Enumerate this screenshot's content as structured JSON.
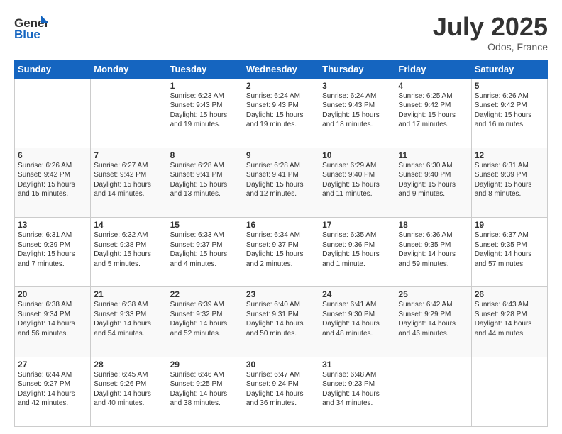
{
  "logo": {
    "general": "General",
    "blue": "Blue"
  },
  "title": "July 2025",
  "location": "Odos, France",
  "days_of_week": [
    "Sunday",
    "Monday",
    "Tuesday",
    "Wednesday",
    "Thursday",
    "Friday",
    "Saturday"
  ],
  "weeks": [
    [
      {
        "day": "",
        "sunrise": "",
        "sunset": "",
        "daylight": ""
      },
      {
        "day": "",
        "sunrise": "",
        "sunset": "",
        "daylight": ""
      },
      {
        "day": "1",
        "sunrise": "Sunrise: 6:23 AM",
        "sunset": "Sunset: 9:43 PM",
        "daylight": "Daylight: 15 hours and 19 minutes."
      },
      {
        "day": "2",
        "sunrise": "Sunrise: 6:24 AM",
        "sunset": "Sunset: 9:43 PM",
        "daylight": "Daylight: 15 hours and 19 minutes."
      },
      {
        "day": "3",
        "sunrise": "Sunrise: 6:24 AM",
        "sunset": "Sunset: 9:43 PM",
        "daylight": "Daylight: 15 hours and 18 minutes."
      },
      {
        "day": "4",
        "sunrise": "Sunrise: 6:25 AM",
        "sunset": "Sunset: 9:42 PM",
        "daylight": "Daylight: 15 hours and 17 minutes."
      },
      {
        "day": "5",
        "sunrise": "Sunrise: 6:26 AM",
        "sunset": "Sunset: 9:42 PM",
        "daylight": "Daylight: 15 hours and 16 minutes."
      }
    ],
    [
      {
        "day": "6",
        "sunrise": "Sunrise: 6:26 AM",
        "sunset": "Sunset: 9:42 PM",
        "daylight": "Daylight: 15 hours and 15 minutes."
      },
      {
        "day": "7",
        "sunrise": "Sunrise: 6:27 AM",
        "sunset": "Sunset: 9:42 PM",
        "daylight": "Daylight: 15 hours and 14 minutes."
      },
      {
        "day": "8",
        "sunrise": "Sunrise: 6:28 AM",
        "sunset": "Sunset: 9:41 PM",
        "daylight": "Daylight: 15 hours and 13 minutes."
      },
      {
        "day": "9",
        "sunrise": "Sunrise: 6:28 AM",
        "sunset": "Sunset: 9:41 PM",
        "daylight": "Daylight: 15 hours and 12 minutes."
      },
      {
        "day": "10",
        "sunrise": "Sunrise: 6:29 AM",
        "sunset": "Sunset: 9:40 PM",
        "daylight": "Daylight: 15 hours and 11 minutes."
      },
      {
        "day": "11",
        "sunrise": "Sunrise: 6:30 AM",
        "sunset": "Sunset: 9:40 PM",
        "daylight": "Daylight: 15 hours and 9 minutes."
      },
      {
        "day": "12",
        "sunrise": "Sunrise: 6:31 AM",
        "sunset": "Sunset: 9:39 PM",
        "daylight": "Daylight: 15 hours and 8 minutes."
      }
    ],
    [
      {
        "day": "13",
        "sunrise": "Sunrise: 6:31 AM",
        "sunset": "Sunset: 9:39 PM",
        "daylight": "Daylight: 15 hours and 7 minutes."
      },
      {
        "day": "14",
        "sunrise": "Sunrise: 6:32 AM",
        "sunset": "Sunset: 9:38 PM",
        "daylight": "Daylight: 15 hours and 5 minutes."
      },
      {
        "day": "15",
        "sunrise": "Sunrise: 6:33 AM",
        "sunset": "Sunset: 9:37 PM",
        "daylight": "Daylight: 15 hours and 4 minutes."
      },
      {
        "day": "16",
        "sunrise": "Sunrise: 6:34 AM",
        "sunset": "Sunset: 9:37 PM",
        "daylight": "Daylight: 15 hours and 2 minutes."
      },
      {
        "day": "17",
        "sunrise": "Sunrise: 6:35 AM",
        "sunset": "Sunset: 9:36 PM",
        "daylight": "Daylight: 15 hours and 1 minute."
      },
      {
        "day": "18",
        "sunrise": "Sunrise: 6:36 AM",
        "sunset": "Sunset: 9:35 PM",
        "daylight": "Daylight: 14 hours and 59 minutes."
      },
      {
        "day": "19",
        "sunrise": "Sunrise: 6:37 AM",
        "sunset": "Sunset: 9:35 PM",
        "daylight": "Daylight: 14 hours and 57 minutes."
      }
    ],
    [
      {
        "day": "20",
        "sunrise": "Sunrise: 6:38 AM",
        "sunset": "Sunset: 9:34 PM",
        "daylight": "Daylight: 14 hours and 56 minutes."
      },
      {
        "day": "21",
        "sunrise": "Sunrise: 6:38 AM",
        "sunset": "Sunset: 9:33 PM",
        "daylight": "Daylight: 14 hours and 54 minutes."
      },
      {
        "day": "22",
        "sunrise": "Sunrise: 6:39 AM",
        "sunset": "Sunset: 9:32 PM",
        "daylight": "Daylight: 14 hours and 52 minutes."
      },
      {
        "day": "23",
        "sunrise": "Sunrise: 6:40 AM",
        "sunset": "Sunset: 9:31 PM",
        "daylight": "Daylight: 14 hours and 50 minutes."
      },
      {
        "day": "24",
        "sunrise": "Sunrise: 6:41 AM",
        "sunset": "Sunset: 9:30 PM",
        "daylight": "Daylight: 14 hours and 48 minutes."
      },
      {
        "day": "25",
        "sunrise": "Sunrise: 6:42 AM",
        "sunset": "Sunset: 9:29 PM",
        "daylight": "Daylight: 14 hours and 46 minutes."
      },
      {
        "day": "26",
        "sunrise": "Sunrise: 6:43 AM",
        "sunset": "Sunset: 9:28 PM",
        "daylight": "Daylight: 14 hours and 44 minutes."
      }
    ],
    [
      {
        "day": "27",
        "sunrise": "Sunrise: 6:44 AM",
        "sunset": "Sunset: 9:27 PM",
        "daylight": "Daylight: 14 hours and 42 minutes."
      },
      {
        "day": "28",
        "sunrise": "Sunrise: 6:45 AM",
        "sunset": "Sunset: 9:26 PM",
        "daylight": "Daylight: 14 hours and 40 minutes."
      },
      {
        "day": "29",
        "sunrise": "Sunrise: 6:46 AM",
        "sunset": "Sunset: 9:25 PM",
        "daylight": "Daylight: 14 hours and 38 minutes."
      },
      {
        "day": "30",
        "sunrise": "Sunrise: 6:47 AM",
        "sunset": "Sunset: 9:24 PM",
        "daylight": "Daylight: 14 hours and 36 minutes."
      },
      {
        "day": "31",
        "sunrise": "Sunrise: 6:48 AM",
        "sunset": "Sunset: 9:23 PM",
        "daylight": "Daylight: 14 hours and 34 minutes."
      },
      {
        "day": "",
        "sunrise": "",
        "sunset": "",
        "daylight": ""
      },
      {
        "day": "",
        "sunrise": "",
        "sunset": "",
        "daylight": ""
      }
    ]
  ]
}
